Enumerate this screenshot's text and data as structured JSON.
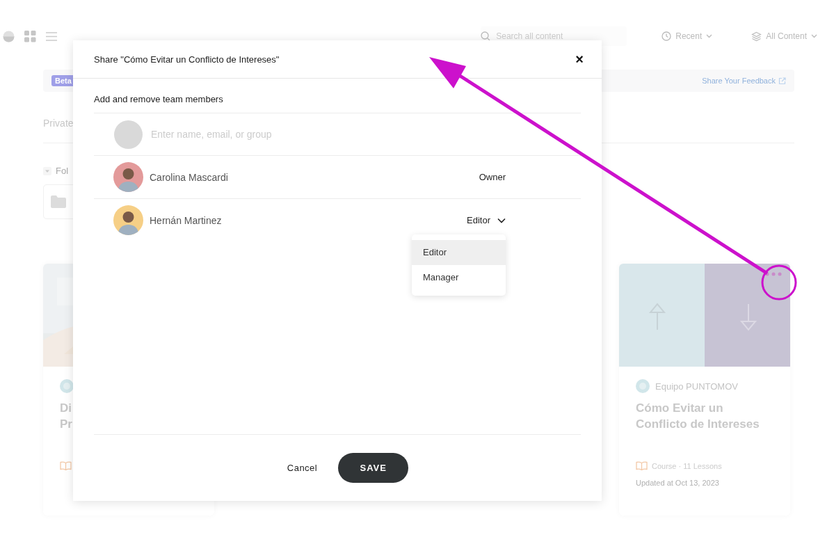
{
  "topbar": {
    "search": {
      "placeholder": "Search all content"
    },
    "filters": [
      {
        "kind": "clock",
        "label": "Recent"
      },
      {
        "kind": "layers",
        "label": "All Content"
      }
    ]
  },
  "banner": {
    "badge": "Beta",
    "link": "Share Your Feedback"
  },
  "section_tab": "Private",
  "folders_label": "Fol",
  "cards": [
    {
      "kind": "picture",
      "title_lines": [
        "Di",
        "Pr"
      ]
    },
    {
      "kind": "arrows",
      "author": "Equipo PUNTOMOV",
      "title": "Cómo Evitar un Conflicto de Intereses",
      "meta": "Course · 11 Lessons",
      "updated": "Updated at Oct 13, 2023"
    }
  ],
  "dialog": {
    "title": "Share \"Cómo Evitar un Conflicto de Intereses\"",
    "close": "×",
    "subtitle": "Add and remove team members",
    "invite": {
      "placeholder": "Enter name, email, or group"
    },
    "members": [
      {
        "name": "Carolina Mascardi",
        "role": "Owner",
        "editable": false,
        "color": "#e39a9a"
      },
      {
        "name": "Hernán Martinez",
        "role": "Editor",
        "editable": true,
        "color": "#f6cf86"
      }
    ],
    "role_menu": [
      {
        "label": "Editor",
        "selected": true
      },
      {
        "label": "Manager",
        "selected": false
      }
    ],
    "buttons": {
      "cancel": "Cancel",
      "save": "SAVE"
    }
  }
}
